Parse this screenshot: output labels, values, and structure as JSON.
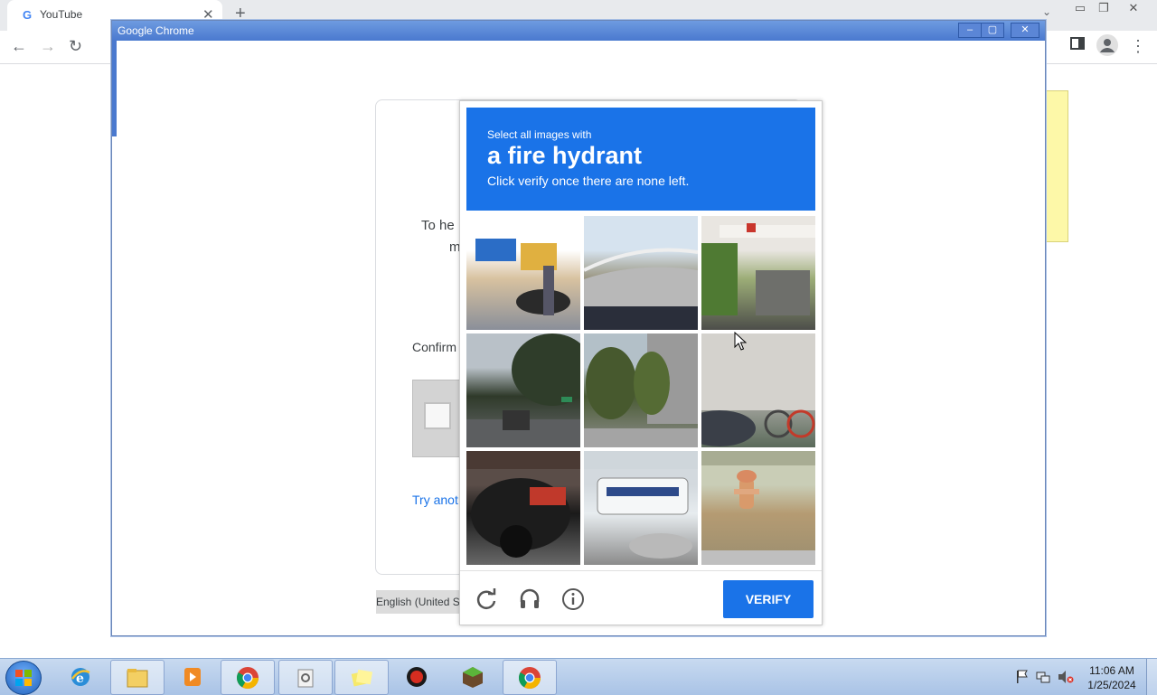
{
  "chrome": {
    "tab_title": "YouTube",
    "tab_favicon": "G",
    "tab_close": "✕",
    "new_tab": "+",
    "tab_search": "⌄"
  },
  "window": {
    "title": "Google Chrome"
  },
  "page": {
    "text_line1": "To he",
    "text_line2": "m",
    "confirm_text": "Confirm",
    "try_another": "Try anot",
    "language": "English (United S"
  },
  "captcha": {
    "instruction_small": "Select all images with",
    "target": "a fire hydrant",
    "instruction_sub": "Click verify once there are none left.",
    "verify_label": "VERIFY",
    "tiles": [
      {
        "scene": "storefront with motorcycle",
        "top": "#ffffff",
        "mid": "#d8c2a0",
        "bottom": "#8a8f99",
        "accent": "#2b6dc6"
      },
      {
        "scene": "curving road",
        "top": "#d6e3ef",
        "mid": "#9a9580",
        "bottom": "#c9c9c9",
        "accent": "#2a2e3a"
      },
      {
        "scene": "gas station",
        "top": "#e9e6e1",
        "mid": "#9cad77",
        "bottom": "#4d4e4a",
        "accent": "#c9362c"
      },
      {
        "scene": "street with tree",
        "top": "#b9c1c8",
        "mid": "#2f3a2a",
        "bottom": "#6b6d70",
        "accent": "#2e8b57"
      },
      {
        "scene": "trees and building",
        "top": "#b3c0c8",
        "mid": "#4a5b34",
        "bottom": "#8f8f8f",
        "accent": "#6a6a6a"
      },
      {
        "scene": "wall with bicycles",
        "top": "#d7d5d0",
        "mid": "#b0aea9",
        "bottom": "#5a6a5a",
        "accent": "#c23a2a"
      },
      {
        "scene": "motorcycle close-up",
        "top": "#5a4d48",
        "mid": "#1a1a1a",
        "bottom": "#686868",
        "accent": "#c0392b"
      },
      {
        "scene": "bus on road",
        "top": "#d3d9de",
        "mid": "#e7ecef",
        "bottom": "#8b8b8b",
        "accent": "#2d4a8a"
      },
      {
        "scene": "fire hydrant on grass",
        "top": "#c9cdb6",
        "mid": "#b59b72",
        "bottom": "#9a8e70",
        "accent": "#d99a6b"
      }
    ]
  },
  "taskbar": {
    "clock_time": "11:06 AM",
    "clock_date": "1/25/2024",
    "apps": [
      "explorer-icon",
      "media-player-icon",
      "chrome-icon",
      "settings-icon",
      "sticky-notes-icon",
      "antivirus-icon",
      "minecraft-icon",
      "chrome-icon"
    ]
  },
  "colors": {
    "captcha_blue": "#1a73e8",
    "link_blue": "#1a73e8",
    "taskbar": "#b9cfec"
  }
}
